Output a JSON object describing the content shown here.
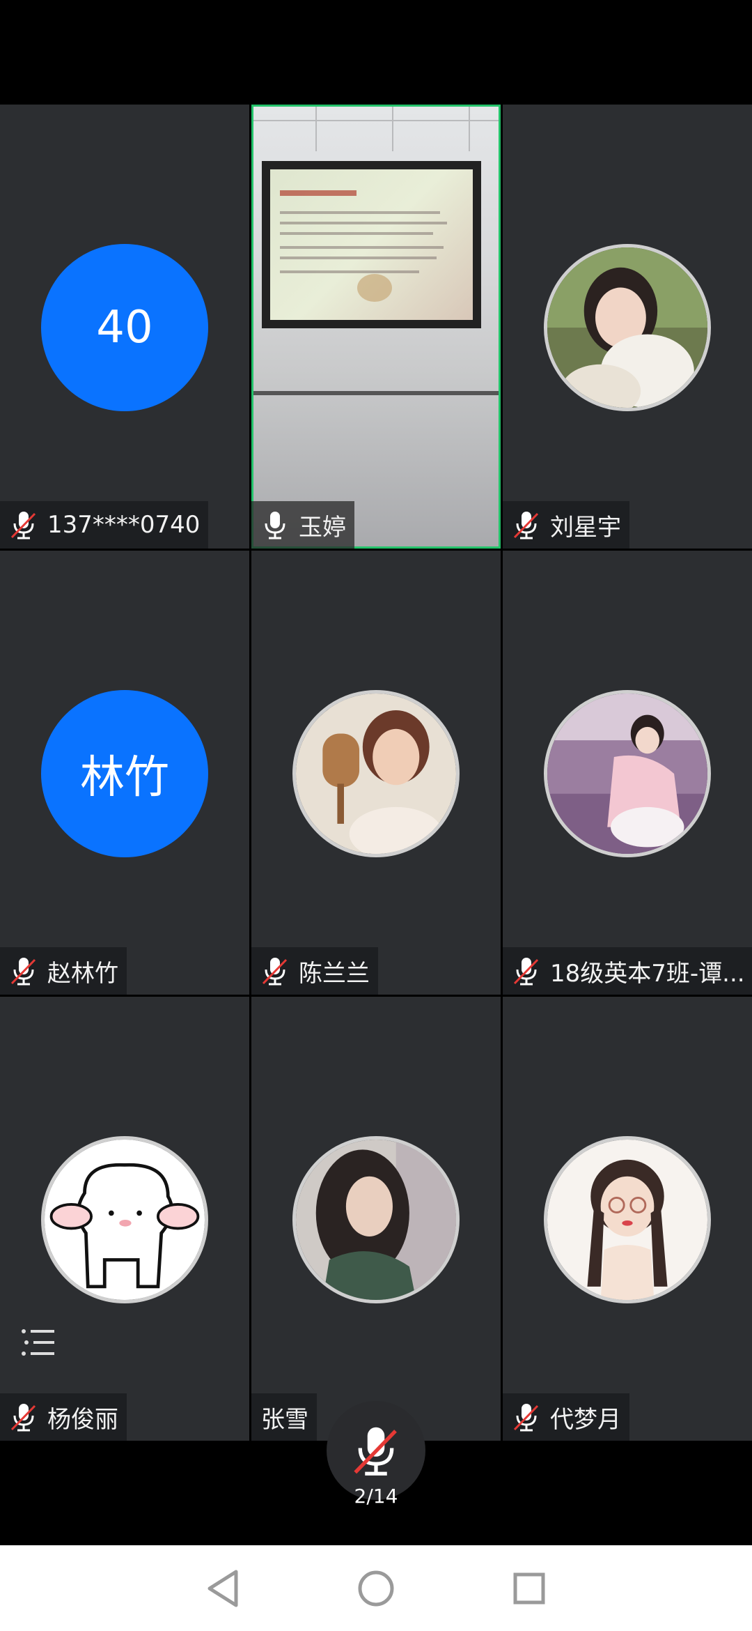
{
  "participants": [
    {
      "name": "137****0740",
      "avatar_text": "40",
      "mic": "muted"
    },
    {
      "name": "玉婷",
      "mic": "on",
      "video": true
    },
    {
      "name": "刘星宇",
      "mic": "muted"
    },
    {
      "name": "赵林竹",
      "avatar_text": "林竹",
      "mic": "muted"
    },
    {
      "name": "陈兰兰",
      "mic": "muted"
    },
    {
      "name": "18级英本7班-谭...",
      "mic": "muted"
    },
    {
      "name": "杨俊丽",
      "mic": "muted"
    },
    {
      "name": "张雪",
      "mic": "none"
    },
    {
      "name": "代梦月",
      "mic": "muted"
    }
  ],
  "controls": {
    "page_indicator": "2/14",
    "mic_icon": "mic-muted-icon",
    "chat_icon": "list-icon"
  },
  "colors": {
    "tile_bg": "#2c2e31",
    "active_border": "#23c36a",
    "letter_avatar": "#0a73ff",
    "muted_slash": "#e53935"
  }
}
